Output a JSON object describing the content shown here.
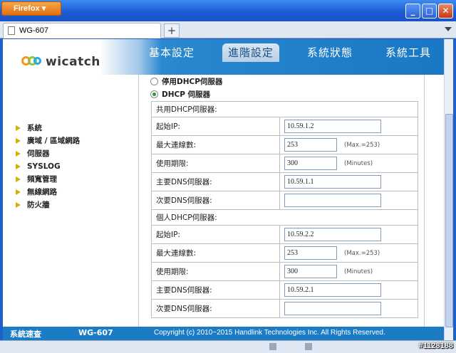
{
  "browser": {
    "app_button": "Firefox",
    "tab_title": "WG-607",
    "new_tab": "+"
  },
  "window_buttons": {
    "minimize": "_",
    "maximize": "□",
    "close": "✕"
  },
  "brand": {
    "logo_text": "wicatch"
  },
  "nav": [
    {
      "label": "基本設定",
      "active": false
    },
    {
      "label": "進階設定",
      "active": true
    },
    {
      "label": "系統狀態",
      "active": false
    },
    {
      "label": "系統工具",
      "active": false
    }
  ],
  "sidebar": [
    "系統",
    "廣域 / 區域網路",
    "伺服器",
    "SYSLOG",
    "頻寬管理",
    "無線網路",
    "防火牆"
  ],
  "dhcp": {
    "disable_option": "停用DHCP伺服器",
    "enable_option": "DHCP 伺服器",
    "selected": "DHCP 伺服器",
    "shared": {
      "title": "共用DHCP伺服器:",
      "start_ip_label": "起始IP:",
      "start_ip": "10.59.1.2",
      "max_conn_label": "最大連線數:",
      "max_conn": "253",
      "max_hint": "(Max.=253)",
      "lease_label": "使用期限:",
      "lease": "300",
      "lease_hint": "(Minutes)",
      "dns1_label": "主要DNS伺服器:",
      "dns1": "10.59.1.1",
      "dns2_label": "次要DNS伺服器:",
      "dns2": ""
    },
    "private": {
      "title": "個人DHCP伺服器:",
      "start_ip_label": "起始IP:",
      "start_ip": "10.59.2.2",
      "max_conn_label": "最大連線數:",
      "max_conn": "253",
      "max_hint": "(Max.=253)",
      "lease_label": "使用期限:",
      "lease": "300",
      "lease_hint": "(Minutes)",
      "dns1_label": "主要DNS伺服器:",
      "dns1": "10.59.2.1",
      "dns2_label": "次要DNS伺服器:",
      "dns2": ""
    }
  },
  "footer": {
    "left": "系統速查",
    "model": "WG-607",
    "copyright": "Copyright (c) 2010~2015 Handlink Technologies Inc. All Rights Reserved."
  },
  "watermark": "#1128188"
}
